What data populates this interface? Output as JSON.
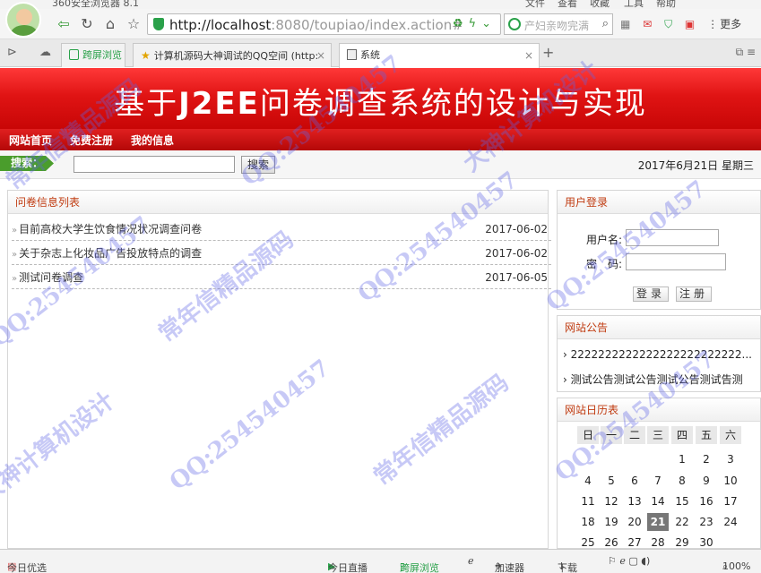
{
  "browser": {
    "title": "360安全浏览器 8.1",
    "menu": [
      "文件",
      "查看",
      "收藏",
      "工具",
      "帮助"
    ],
    "url_host": "http://localhost",
    "url_path": ":8080/toupiao/index.action#",
    "search_placeholder": "产妇亲吻完满",
    "more_label": "更多"
  },
  "tabs": [
    {
      "label": "跨屏浏览"
    },
    {
      "label": "计算机源码大神调试的QQ空间 (http:"
    },
    {
      "label": "系统"
    }
  ],
  "banner": {
    "title_pre": "基于",
    "title_bold": "J2EE",
    "title_post": "问卷调查系统的设计与实现"
  },
  "nav": {
    "home": "网站首页",
    "register": "免费注册",
    "myinfo": "我的信息"
  },
  "search": {
    "label": "搜索：",
    "button": "搜索",
    "date": "2017年6月21日 星期三"
  },
  "list": {
    "title": "问卷信息列表",
    "rows": [
      {
        "title": "目前高校大学生饮食情况状况调查问卷",
        "date": "2017-06-02"
      },
      {
        "title": "关于杂志上化妆品广告投放特点的调查",
        "date": "2017-06-02"
      },
      {
        "title": "测试问卷调查",
        "date": "2017-06-05"
      }
    ]
  },
  "login": {
    "title": "用户登录",
    "username_label": "用户名:",
    "password_label": "密　码:",
    "login_button": "登录",
    "register_button": "注册"
  },
  "notice": {
    "title": "网站公告",
    "items": [
      "2222222222222222222222222...",
      "测试公告测试公告测试公告测试告测"
    ]
  },
  "calendar": {
    "title": "网站日历表",
    "weekdays": [
      "日",
      "一",
      "二",
      "三",
      "四",
      "五",
      "六"
    ],
    "days": [
      "",
      "",
      "",
      "",
      "1",
      "2",
      "3",
      "4",
      "5",
      "6",
      "7",
      "8",
      "9",
      "10",
      "11",
      "12",
      "13",
      "14",
      "15",
      "16",
      "17",
      "18",
      "19",
      "20",
      "21",
      "22",
      "23",
      "24",
      "25",
      "26",
      "27",
      "28",
      "29",
      "30"
    ],
    "today": "21"
  },
  "statusbar": {
    "left": "今日优选",
    "live": "今日直播",
    "cross": "跨屏浏览",
    "accel": "加速器",
    "download": "下载",
    "zoom": "100%"
  },
  "watermark": [
    "QQ:254540457",
    "常年信精品源码",
    "大神计算机设计"
  ]
}
